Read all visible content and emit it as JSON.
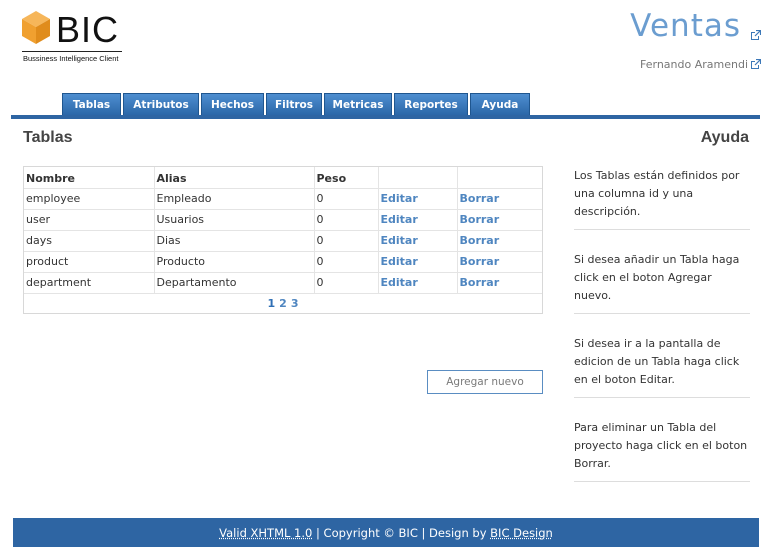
{
  "logo": {
    "word": "BIC",
    "tagline": "Bussiness Intelligence Client"
  },
  "header": {
    "title": "Ventas",
    "user": "Fernando Aramendi"
  },
  "tabs": [
    {
      "label": "Tablas"
    },
    {
      "label": "Atributos"
    },
    {
      "label": "Hechos"
    },
    {
      "label": "Filtros"
    },
    {
      "label": "Metricas"
    },
    {
      "label": "Reportes"
    },
    {
      "label": "Ayuda"
    }
  ],
  "section": {
    "title": "Tablas",
    "help_title": "Ayuda"
  },
  "table": {
    "headers": [
      "Nombre",
      "Alias",
      "Peso",
      "",
      ""
    ],
    "rows": [
      {
        "nombre": "employee",
        "alias": "Empleado",
        "peso": "0",
        "edit": "Editar",
        "delete": "Borrar"
      },
      {
        "nombre": "user",
        "alias": "Usuarios",
        "peso": "0",
        "edit": "Editar",
        "delete": "Borrar"
      },
      {
        "nombre": "days",
        "alias": "Dias",
        "peso": "0",
        "edit": "Editar",
        "delete": "Borrar"
      },
      {
        "nombre": "product",
        "alias": "Producto",
        "peso": "0",
        "edit": "Editar",
        "delete": "Borrar"
      },
      {
        "nombre": "department",
        "alias": "Departamento",
        "peso": "0",
        "edit": "Editar",
        "delete": "Borrar"
      }
    ],
    "pages": [
      "1",
      "2",
      "3"
    ]
  },
  "add_button": "Agregar nuevo",
  "help": [
    "Los Tablas están definidos por una columna id y una descripción.",
    "Si desea añadir un Tabla haga click en el boton Agregar nuevo.",
    "Si desea ir a la pantalla de edicion de un Tabla haga click en el boton Editar.",
    "Para eliminar un Tabla del proyecto haga click en el boton Borrar."
  ],
  "footer": {
    "xhtml_link": "Valid XHTML 1.0",
    "copyright": " | Copyright © BIC | Design by ",
    "design_link": "BIC Design"
  },
  "colors": {
    "brand_blue": "#2e65a3",
    "title_blue": "#6b9dd0",
    "link_blue": "#4f86c0",
    "logo_orange": "#f0a030"
  }
}
